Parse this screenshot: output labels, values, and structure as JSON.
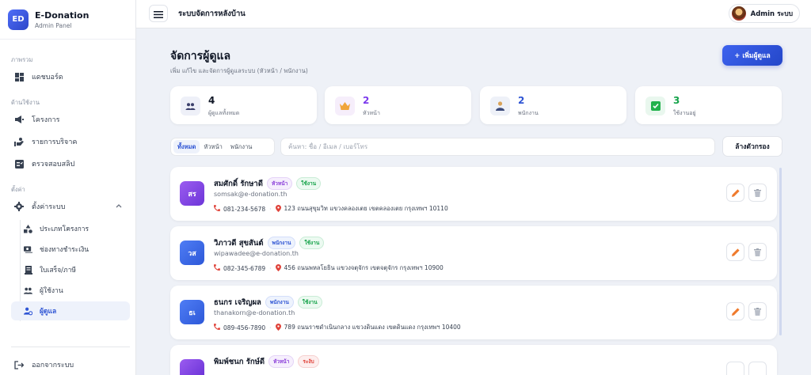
{
  "brand": {
    "logo": "ED",
    "title": "E-Donation",
    "subtitle": "Admin Panel"
  },
  "sidebar": {
    "section_overview": "ภาพรวม",
    "dashboard": "แดชบอร์ด",
    "section_work": "ด้านใช้งาน",
    "projects": "โครงการ",
    "donations": "รายการบริจาค",
    "slips": "ตรวจสอบสลิป",
    "section_settings": "ตั้งค่า",
    "system_settings": "ตั้งค่าระบบ",
    "sub_items": [
      "ประเภทโครงการ",
      "ช่องทางชำระเงิน",
      "ใบเสร็จ/ภาษี",
      "ผู้ใช้งาน",
      "ผู้ดูแล"
    ],
    "logout": "ออกจากระบบ"
  },
  "topbar": {
    "title": "ระบบจัดการหลังบ้าน",
    "user": "Admin ระบบ"
  },
  "page": {
    "title": "จัดการผู้ดูแล",
    "subtitle": "เพิ่ม แก้ไข และจัดการผู้ดูแลระบบ (หัวหน้า / พนักงาน)",
    "add_button": "+ เพิ่มผู้ดูแล"
  },
  "stats": [
    {
      "value": "4",
      "label": "ผู้ดูแลทั้งหมด",
      "color": "#111827",
      "icon": "users-icon"
    },
    {
      "value": "2",
      "label": "หัวหน้า",
      "color": "#7c3aed",
      "icon": "crown-icon"
    },
    {
      "value": "2",
      "label": "พนักงาน",
      "color": "#2f55d4",
      "icon": "staff-icon"
    },
    {
      "value": "3",
      "label": "ใช้งานอยู่",
      "color": "#15a34a",
      "icon": "check-icon"
    }
  ],
  "filters": {
    "tabs": [
      "ทั้งหมด",
      "หัวหน้า",
      "พนักงาน"
    ],
    "search_placeholder": "ค้นหา: ชื่อ / อีเมล / เบอร์โทร",
    "clear_button": "ล้างตัวกรอง"
  },
  "admins": [
    {
      "initials": "สร",
      "name": "สมศักดิ์ รักษาดี",
      "role": "หัวหน้า",
      "status": "ใช้งาน",
      "email": "somsak@e-donation.th",
      "phone": "081-234-5678",
      "address": "123 ถนนสุขุมวิท แขวงคลองเตย เขตคลองเตย กรุงเทพฯ 10110"
    },
    {
      "initials": "วส",
      "name": "วิภาวดี สุขสันต์",
      "role": "พนักงาน",
      "status": "ใช้งาน",
      "email": "wipawadee@e-donation.th",
      "phone": "082-345-6789",
      "address": "456 ถนนพหลโยธิน แขวงจตุจักร เขตจตุจักร กรุงเทพฯ 10900"
    },
    {
      "initials": "ธเ",
      "name": "ธนกร เจริญผล",
      "role": "พนักงาน",
      "status": "ใช้งาน",
      "email": "thanakorn@e-donation.th",
      "phone": "089-456-7890",
      "address": "789 ถนนราชดำเนินกลาง แขวงดินแดง เขตดินแดง กรุงเทพฯ 10400"
    },
    {
      "initials": "พร",
      "name": "พิมพ์ชนก รักษ์ดี",
      "role": "หัวหน้า",
      "status": "ระงับ",
      "email": "",
      "phone": "",
      "address": ""
    }
  ]
}
